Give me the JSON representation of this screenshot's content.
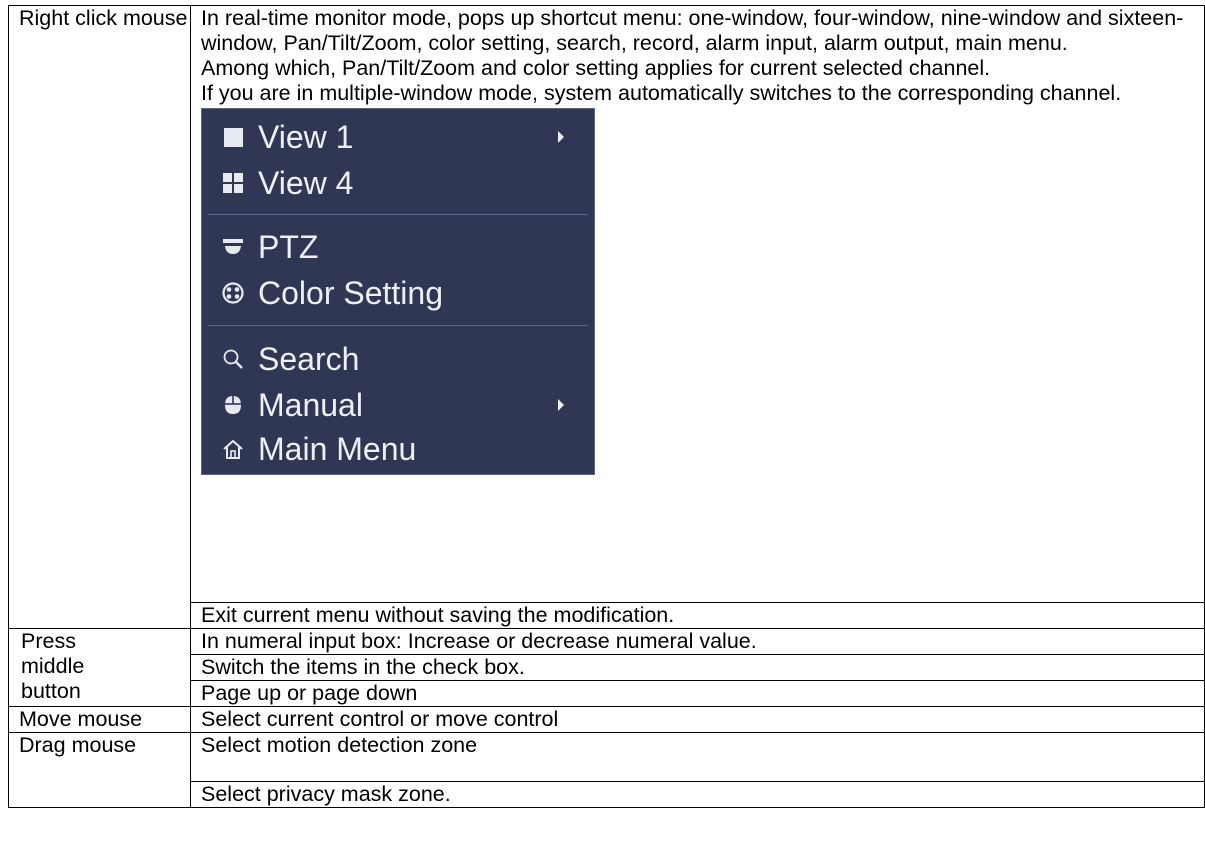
{
  "rows": {
    "right_click": {
      "label": "Right click mouse",
      "p1": "In real-time monitor mode, pops up shortcut menu: one-window, four-window, nine-window and sixteen-window, Pan/Tilt/Zoom, color setting, search, record, alarm input, alarm output, main menu.",
      "p2": "Among which, Pan/Tilt/Zoom and color setting applies for current selected channel.",
      "p3": "If you are in multiple-window mode, system automatically switches to the corresponding channel.",
      "exit": "Exit current menu without saving the modification."
    },
    "middle": {
      "label": "Press middle button",
      "r1": "In numeral input box:  Increase or decrease numeral value.",
      "r2": "Switch the items in the check box.",
      "r3": "Page up or page down"
    },
    "move": {
      "label": "Move mouse",
      "r1": "Select current control or move control"
    },
    "drag": {
      "label": "Drag mouse",
      "r1": "Select motion detection zone",
      "r2": "Select privacy mask zone."
    }
  },
  "menu": {
    "view1": "View 1",
    "view4": "View 4",
    "ptz": "PTZ",
    "color": "Color Setting",
    "search": "Search",
    "manual": "Manual",
    "main": "Main Menu",
    "icons": [
      "square-view-icon",
      "grid-view-icon",
      "dome-camera-icon",
      "palette-icon",
      "search-icon",
      "mouse-icon",
      "home-icon"
    ],
    "colors": {
      "background": "#2f3754",
      "text": "#eef0f6",
      "separator": "#5d6888"
    }
  }
}
